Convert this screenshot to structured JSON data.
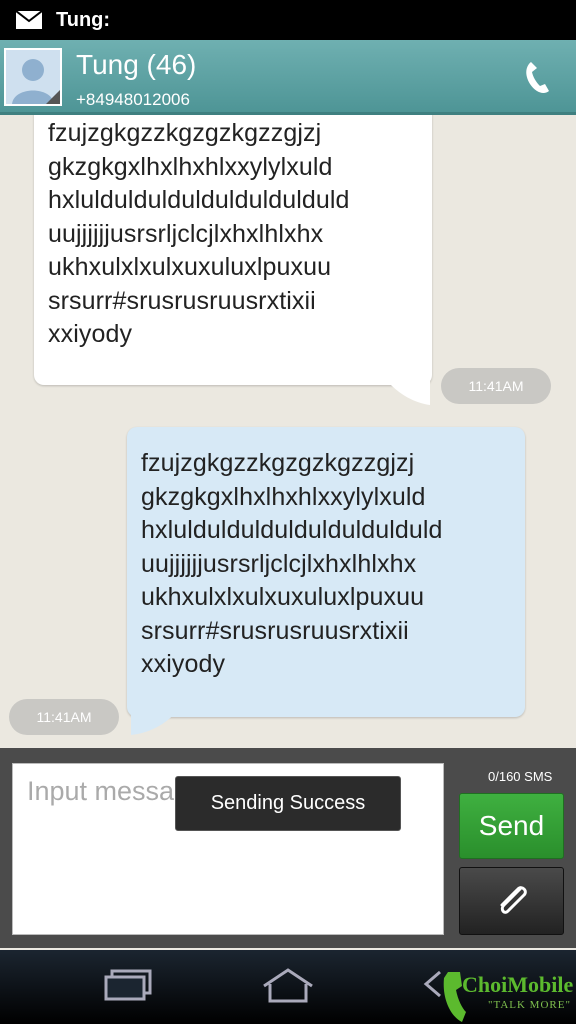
{
  "statusbar": {
    "title": "Tung:",
    "icon": "mail-icon"
  },
  "header": {
    "contact_name": "Tung (46)",
    "contact_number": "+84948012006",
    "call_icon": "phone-icon"
  },
  "messages": [
    {
      "direction": "incoming",
      "lines": [
        "fzujzgkgzzkgzgzkgzzgjzj",
        "gkzgkgxlhxlhxhlxxylylxuld",
        "hxlulduldulduldulduldulduld",
        "uujjjjjjusrsrljclcjlxhxlhlxhx",
        "ukhxulxlxulxuxuluxlpuxuu",
        "srsurr#srusrusruusrxtixii",
        "xxiyody"
      ],
      "time": "11:41AM"
    },
    {
      "direction": "outgoing",
      "lines": [
        "fzujzgkgzzkgzgzkgzzgjzj",
        "gkzgkgxlhxlhxhlxxylylxuld",
        "hxlulduldulduldulduldulduld",
        "uujjjjjjusrsrljclcjlxhxlhlxhx",
        "ukhxulxlxulxuxuluxlpuxuu",
        "srsurr#srusrusruusrxtixii",
        "xxiyody"
      ],
      "time": "11:41AM"
    }
  ],
  "composer": {
    "placeholder": "Input message",
    "counter": "0/160  SMS",
    "send_label": "Send",
    "attach_icon": "paperclip-icon"
  },
  "toast": "Sending Success",
  "watermark": {
    "text": "ChoiMobile",
    "tagline": "\"TALK MORE\""
  },
  "colors": {
    "header": "#5aa0a1",
    "send": "#2f9e31",
    "incoming_bubble": "#ffffff",
    "outgoing_bubble": "#d7e9f6"
  }
}
